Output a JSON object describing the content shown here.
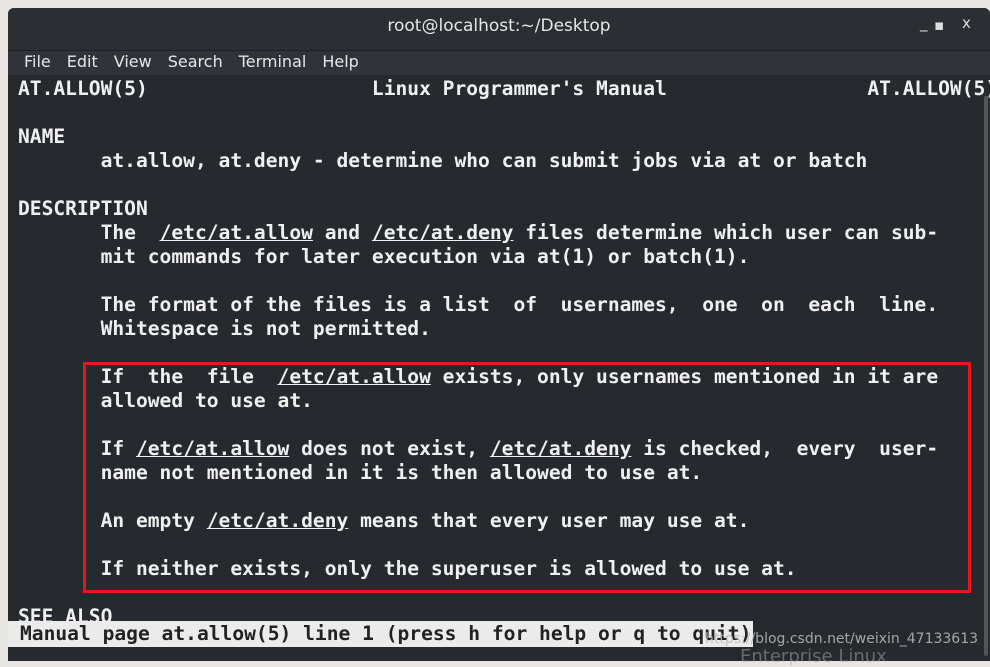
{
  "window": {
    "title": "root@localhost:~/Desktop",
    "minimize": "_",
    "maximize": "▫",
    "close": "x"
  },
  "menu": [
    "File",
    "Edit",
    "View",
    "Search",
    "Terminal",
    "Help"
  ],
  "lines": [
    {
      "row": 0,
      "segs": [
        {
          "t": "AT.ALLOW(5)                   Linux Programmer's Manual                 AT.ALLOW(5)"
        }
      ]
    },
    {
      "row": 2,
      "segs": [
        {
          "t": "NAME"
        }
      ]
    },
    {
      "row": 3,
      "segs": [
        {
          "t": "       at.allow, at.deny - determine who can submit jobs via at or batch"
        }
      ]
    },
    {
      "row": 5,
      "segs": [
        {
          "t": "DESCRIPTION"
        }
      ]
    },
    {
      "row": 6,
      "segs": [
        {
          "t": "       The  "
        },
        {
          "t": "/etc/at.allow",
          "s": "u"
        },
        {
          "t": " and "
        },
        {
          "t": "/etc/at.deny",
          "s": "u"
        },
        {
          "t": " files determine which user can sub-"
        }
      ]
    },
    {
      "row": 7,
      "segs": [
        {
          "t": "       mit commands for later execution via "
        },
        {
          "t": "at",
          "s": "b"
        },
        {
          "t": "(1) or "
        },
        {
          "t": "batch",
          "s": "b"
        },
        {
          "t": "(1)."
        }
      ]
    },
    {
      "row": 9,
      "segs": [
        {
          "t": "       The format of the files is a list  of  usernames,  one  on  each  line."
        }
      ]
    },
    {
      "row": 10,
      "segs": [
        {
          "t": "       Whitespace is not permitted."
        }
      ]
    },
    {
      "row": 12,
      "segs": [
        {
          "t": "       If  the  file  "
        },
        {
          "t": "/etc/at.allow",
          "s": "u"
        },
        {
          "t": " exists, only usernames mentioned in it are"
        }
      ]
    },
    {
      "row": 13,
      "segs": [
        {
          "t": "       allowed to use "
        },
        {
          "t": "at",
          "s": "b"
        },
        {
          "t": "."
        }
      ]
    },
    {
      "row": 15,
      "segs": [
        {
          "t": "       If "
        },
        {
          "t": "/etc/at.allow",
          "s": "u"
        },
        {
          "t": " does not exist, "
        },
        {
          "t": "/etc/at.deny",
          "s": "u"
        },
        {
          "t": " is checked,  every  user-"
        }
      ]
    },
    {
      "row": 16,
      "segs": [
        {
          "t": "       name not mentioned in it is then allowed to use "
        },
        {
          "t": "at",
          "s": "b"
        },
        {
          "t": "."
        }
      ]
    },
    {
      "row": 18,
      "segs": [
        {
          "t": "       An empty "
        },
        {
          "t": "/etc/at.deny",
          "s": "u"
        },
        {
          "t": " means that every user may use "
        },
        {
          "t": "at",
          "s": "b"
        },
        {
          "t": "."
        }
      ]
    },
    {
      "row": 20,
      "segs": [
        {
          "t": "       If neither exists, only the superuser is allowed to use at."
        }
      ]
    },
    {
      "row": 22,
      "segs": [
        {
          "t": "SEE ALSO"
        }
      ]
    }
  ],
  "status": "Manual page at.allow(5) line 1 (press h for help or q to quit)",
  "watermark": "https://blog.csdn.net/weixin_47133613",
  "background_text": "Enterprise Linux",
  "colors": {
    "highlight_box": "#e8161b",
    "terminal_bg": "#262a2e"
  }
}
